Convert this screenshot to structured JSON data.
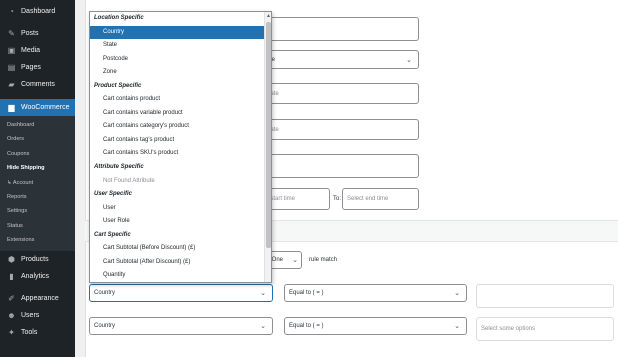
{
  "sidebar": {
    "top": [
      {
        "label": "Dashboard",
        "icon": "dashboard-icon"
      },
      {
        "label": "Posts",
        "icon": "pin-icon"
      },
      {
        "label": "Media",
        "icon": "media-icon"
      },
      {
        "label": "Pages",
        "icon": "pages-icon"
      },
      {
        "label": "Comments",
        "icon": "comments-icon"
      }
    ],
    "current": {
      "label": "WooCommerce",
      "icon": "woocommerce-icon"
    },
    "submenu": [
      "Dashboard",
      "Orders",
      "Coupons",
      "Hide Shipping",
      "↳ Account",
      "Reports",
      "Settings",
      "Status",
      "Extensions"
    ],
    "submenu_active": "Hide Shipping",
    "bottom": [
      {
        "label": "Products",
        "icon": "products-icon"
      },
      {
        "label": "Analytics",
        "icon": "analytics-icon"
      },
      {
        "label": "Appearance",
        "icon": "appearance-icon"
      },
      {
        "label": "Users",
        "icon": "users-icon"
      },
      {
        "label": "Tools",
        "icon": "tools-icon"
      }
    ]
  },
  "form": {
    "rule_select_suffix": "ule",
    "date_placeholder_1": "date",
    "date_placeholder_2": "date",
    "start_time_placeholder": "t start time",
    "to_label": "To:",
    "end_time_placeholder": "Select end time",
    "match_select_value": "y One",
    "match_label": "rule match",
    "condition_rows": [
      {
        "attribute": "Country",
        "operator": "Equal to ( = )",
        "value_placeholder": ""
      },
      {
        "attribute": "Country",
        "operator": "Equal to ( = )",
        "value_placeholder": "Select some options"
      }
    ]
  },
  "dropdown": {
    "groups": [
      {
        "label": "Location Specific",
        "options": [
          {
            "label": "Country",
            "selected": true
          },
          {
            "label": "State"
          },
          {
            "label": "Postcode"
          },
          {
            "label": "Zone"
          }
        ]
      },
      {
        "label": "Product Specific",
        "options": [
          {
            "label": "Cart contains product"
          },
          {
            "label": "Cart contains variable product"
          },
          {
            "label": "Cart contains category's product"
          },
          {
            "label": "Cart contains tag's product"
          },
          {
            "label": "Cart contains SKU's product"
          }
        ]
      },
      {
        "label": "Attribute Specific",
        "options": [
          {
            "label": "Not Found Attribute",
            "disabled": true
          }
        ]
      },
      {
        "label": "User Specific",
        "options": [
          {
            "label": "User"
          },
          {
            "label": "User Role"
          }
        ]
      },
      {
        "label": "Cart Specific",
        "options": [
          {
            "label": "Cart Subtotal (Before Discount) (£)"
          },
          {
            "label": "Cart Subtotal (After Discount) (£)"
          },
          {
            "label": "Quantity"
          }
        ]
      }
    ]
  },
  "colors": {
    "sidebar_bg": "#1d2327",
    "accent": "#2271b1",
    "submenu_bg": "#2c3338"
  }
}
